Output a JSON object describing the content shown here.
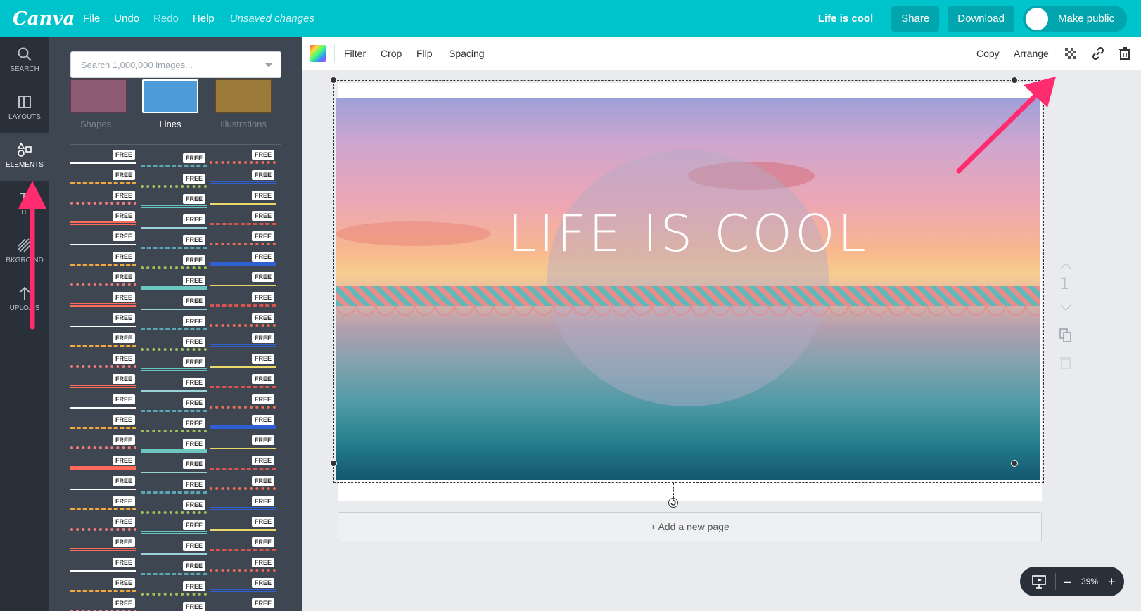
{
  "app": {
    "logo": "Canva",
    "menu": [
      "File",
      "Undo",
      "Redo",
      "Help"
    ],
    "status": "Unsaved changes",
    "doc_title": "Life is cool",
    "share_label": "Share",
    "download_label": "Download",
    "public_label": "Make public"
  },
  "rail": {
    "items": [
      {
        "label": "SEARCH",
        "icon": "search-icon"
      },
      {
        "label": "LAYOUTS",
        "icon": "layouts-icon"
      },
      {
        "label": "ELEMENTS",
        "icon": "elements-icon"
      },
      {
        "label": "TE",
        "icon": "text-icon"
      },
      {
        "label": "BKGRO  ND",
        "icon": "background-icon"
      },
      {
        "label": "UPLOA  S",
        "icon": "upload-icon"
      }
    ]
  },
  "panel": {
    "search_placeholder": "Search 1,000,000 images...",
    "categories": [
      "Shapes",
      "Lines",
      "Illustrations"
    ],
    "free_tag": "FREE"
  },
  "toolbar": {
    "left": [
      "Filter",
      "Crop",
      "Flip",
      "Spacing"
    ],
    "right": [
      "Copy",
      "Arrange"
    ]
  },
  "canvas": {
    "headline": "LIFE IS COOL",
    "page_number": "1",
    "add_page_label": "+ Add a new page"
  },
  "zoom": {
    "value": "39%",
    "minus": "–",
    "plus": "+"
  },
  "colors": {
    "brand": "#00c4cc",
    "rail_bg": "#293039",
    "panel_bg": "#3e4651",
    "annotation_arrow": "#ff2d6f"
  }
}
